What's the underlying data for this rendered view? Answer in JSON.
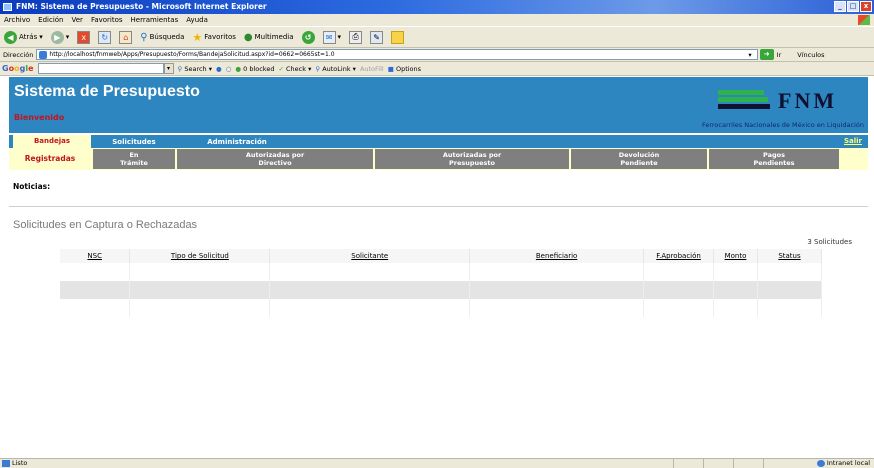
{
  "window": {
    "title": "FNM: Sistema de Presupuesto - Microsoft Internet Explorer",
    "buttons": [
      "_",
      "□",
      "x"
    ]
  },
  "menubar": [
    "Archivo",
    "Edición",
    "Ver",
    "Favoritos",
    "Herramientas",
    "Ayuda"
  ],
  "toolbar": {
    "back": "Atrás",
    "search": "Búsqueda",
    "favorites": "Favoritos",
    "multimedia": "Multimedia"
  },
  "address": {
    "label": "Dirección",
    "url": "http://localhost/fnmweb/Apps/Presupuesto/Forms/BandejaSolicitud.aspx?id=0662=0665st=1.0",
    "go": "Ir",
    "links": "Vínculos"
  },
  "googlebar": {
    "logo": [
      "G",
      "o",
      "o",
      "g",
      "l",
      "e"
    ],
    "search": "Search",
    "blocked": "0 blocked",
    "check": "Check",
    "autolink": "AutoLink",
    "autofill": "AutoFill",
    "options": "Options"
  },
  "header": {
    "title": "Sistema de Presupuesto",
    "welcome": "Bienvenido",
    "logo_text": "FNM",
    "logo_subtitle": "Ferrocarriles Nacionales de México en Liquidación"
  },
  "main_tabs": [
    "Bandejas",
    "Solicitudes",
    "Administración"
  ],
  "logout": "Salir",
  "sub_tabs": [
    [
      "Registradas"
    ],
    [
      "En",
      "Trámite"
    ],
    [
      "Autorizadas por",
      "Directivo"
    ],
    [
      "Autorizadas por",
      "Presupuesto"
    ],
    [
      "Devolución",
      "Pendiente"
    ],
    [
      "Pagos",
      "Pendientes"
    ]
  ],
  "news_label": "Noticias:",
  "section_title": "Solicitudes en Captura o Rechazadas",
  "record_count": "3 Solicitudes",
  "table": {
    "columns": [
      "NSC",
      "Tipo de Solicitud",
      "Solicitante",
      "Beneficiario",
      "F.Aprobación",
      "Monto",
      "Status"
    ],
    "rows": [
      [
        "",
        "",
        "",
        "",
        "",
        "",
        ""
      ],
      [
        "",
        "",
        "",
        "",
        "",
        "",
        ""
      ],
      [
        "",
        "",
        "",
        "",
        "",
        "",
        ""
      ]
    ]
  },
  "statusbar": {
    "text": "Listo",
    "zone": "Intranet local"
  },
  "colors": {
    "header_blue": "#2e86c1",
    "tab_highlight": "#ffffcc",
    "accent_red": "#c0151f",
    "subtab_gray": "#7f7f7f",
    "logo_green": "#2eb34a"
  }
}
